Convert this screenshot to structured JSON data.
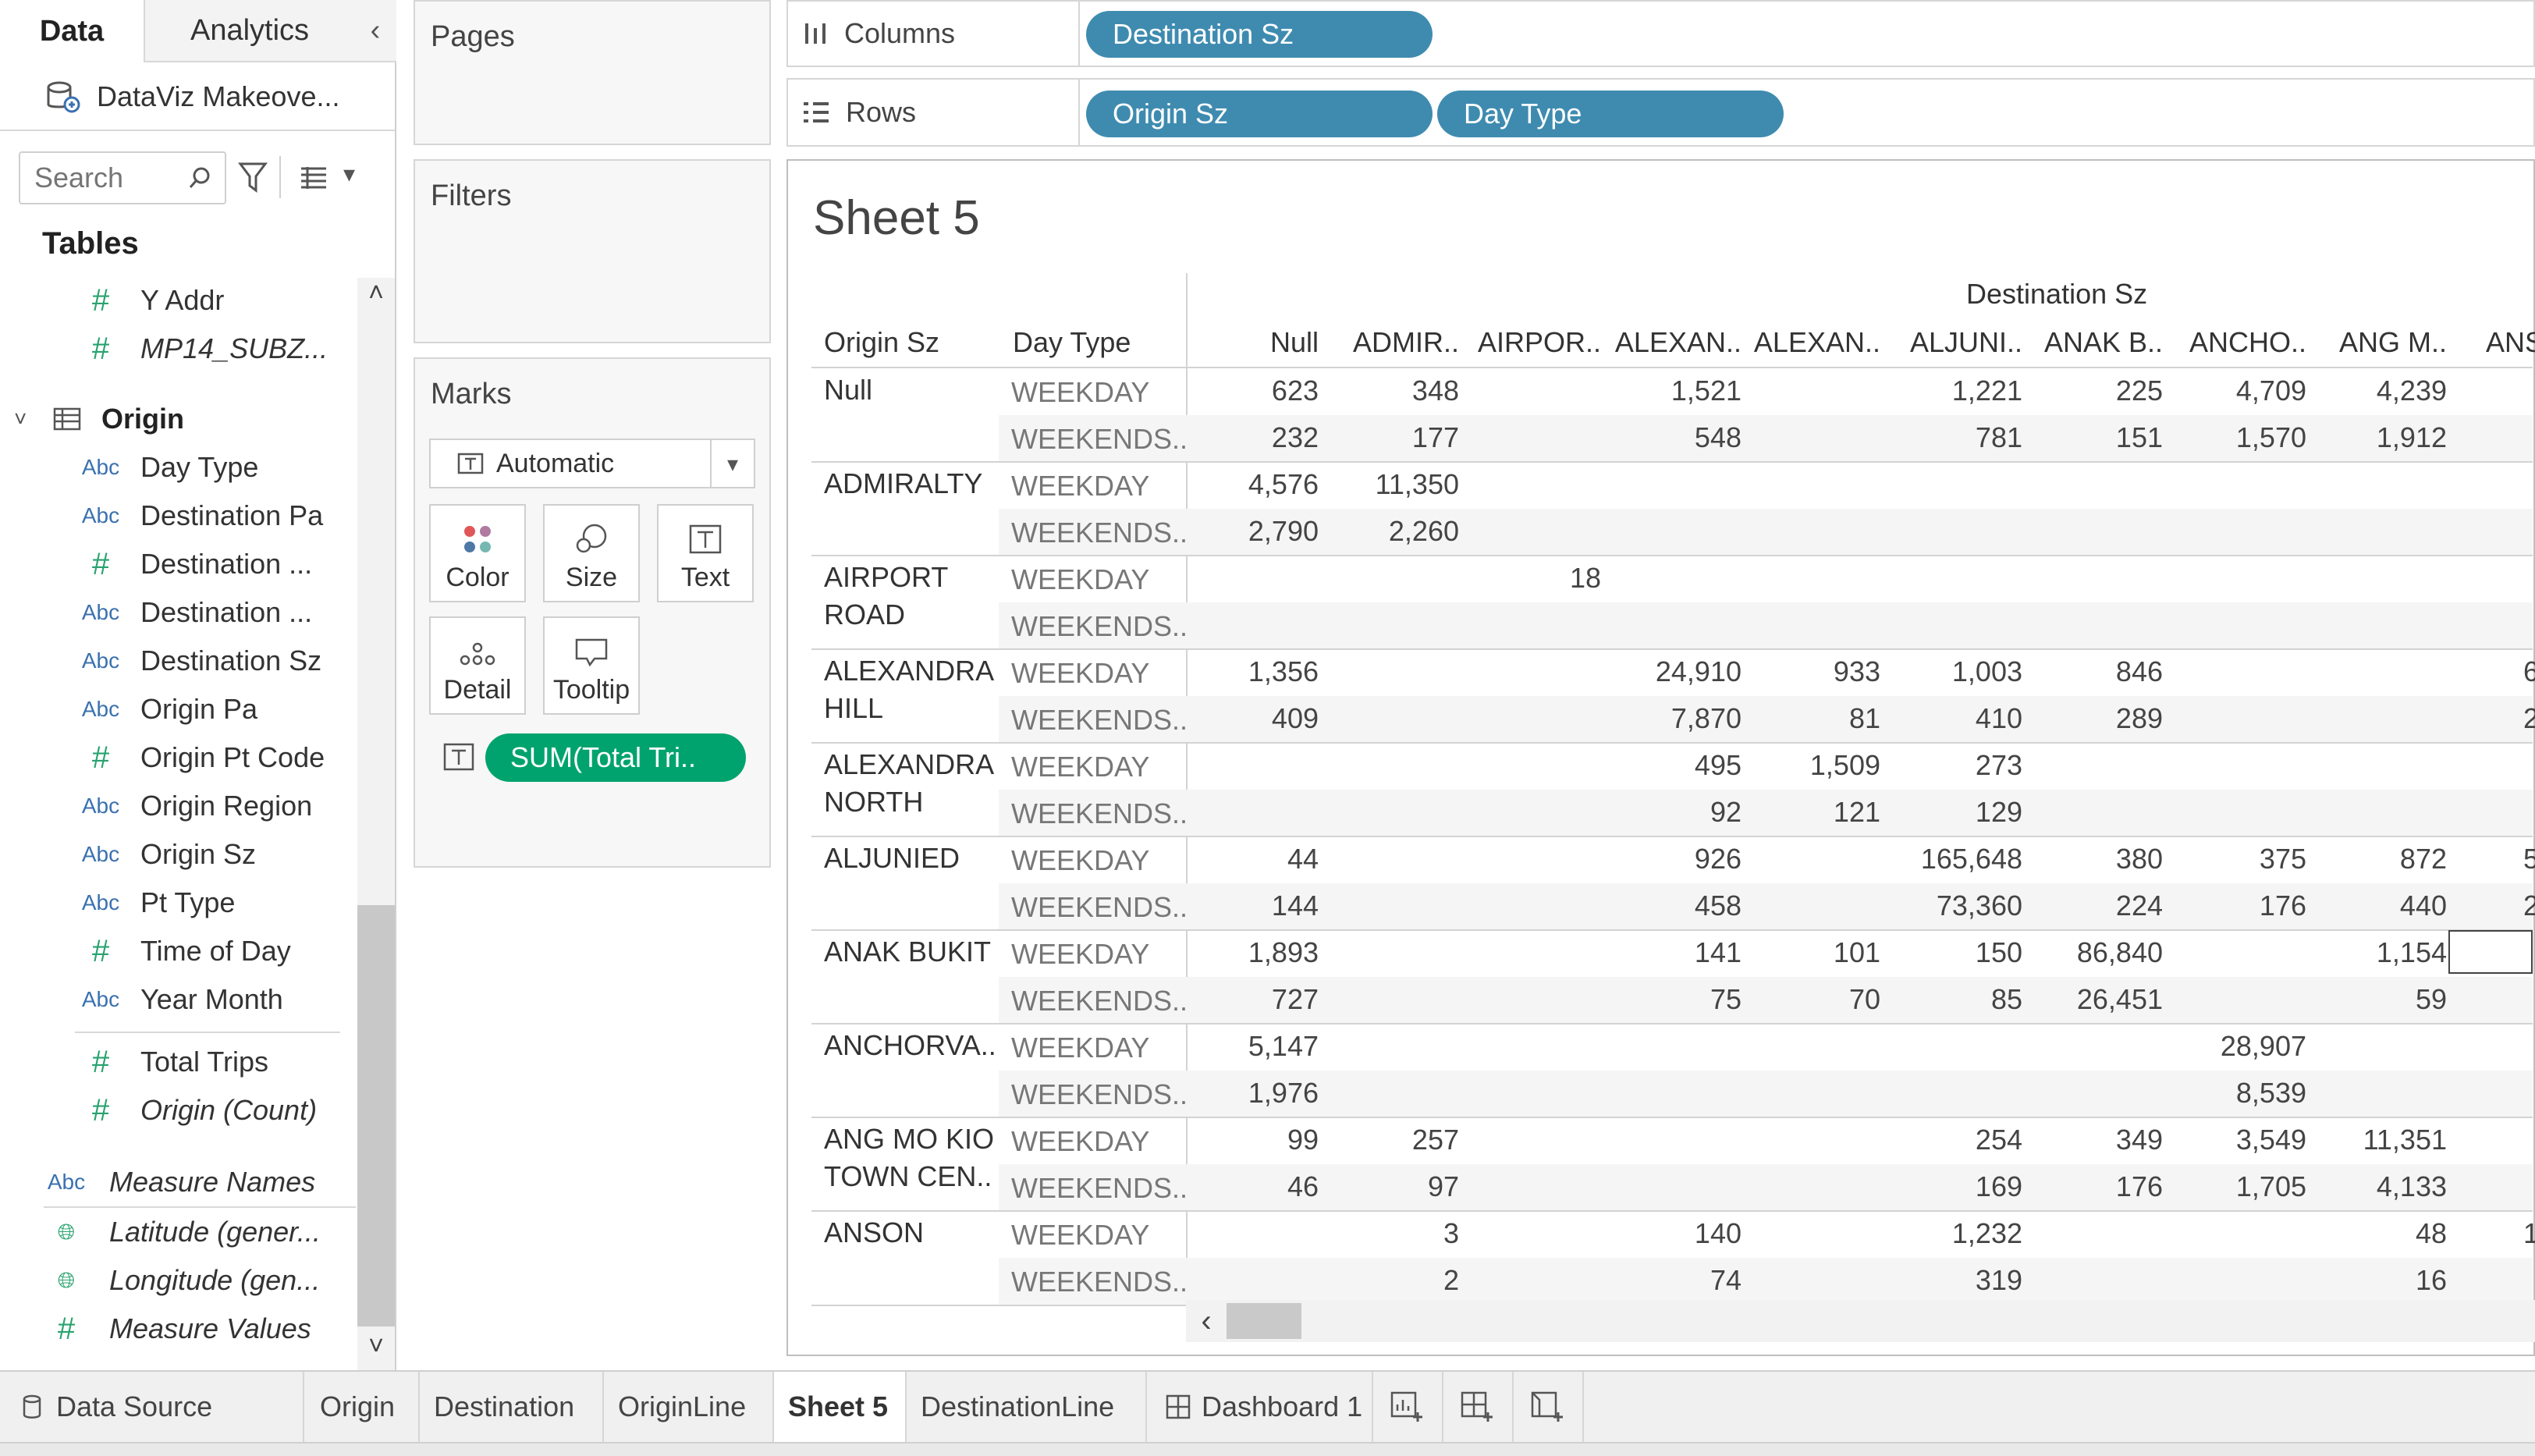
{
  "left_pane": {
    "tab_data": "Data",
    "tab_analytics": "Analytics",
    "datasource_name": "DataViz Makeove...",
    "search_placeholder": "Search",
    "tables_heading": "Tables",
    "fields_top": [
      {
        "type": "#",
        "name": "Y Addr"
      },
      {
        "type": "#",
        "name": "MP14_SUBZ..."
      }
    ],
    "origin_table": "Origin",
    "origin_fields": [
      {
        "type": "Abc",
        "name": "Day Type"
      },
      {
        "type": "Abc",
        "name": "Destination Pa"
      },
      {
        "type": "#",
        "name": "Destination ..."
      },
      {
        "type": "Abc",
        "name": "Destination ..."
      },
      {
        "type": "Abc",
        "name": "Destination Sz"
      },
      {
        "type": "Abc",
        "name": "Origin Pa"
      },
      {
        "type": "#",
        "name": "Origin Pt Code"
      },
      {
        "type": "Abc",
        "name": "Origin Region"
      },
      {
        "type": "Abc",
        "name": "Origin Sz"
      },
      {
        "type": "Abc",
        "name": "Pt Type"
      },
      {
        "type": "#",
        "name": "Time of Day"
      },
      {
        "type": "Abc",
        "name": "Year Month"
      }
    ],
    "origin_measures": [
      {
        "type": "#",
        "name": "Total Trips"
      },
      {
        "type": "#",
        "name": "Origin (Count)"
      }
    ],
    "extra_fields": [
      {
        "type": "Abc",
        "name": "Measure Names"
      },
      {
        "type": "geo",
        "name": "Latitude (gener..."
      },
      {
        "type": "geo",
        "name": "Longitude (gen..."
      },
      {
        "type": "#",
        "name": "Measure Values"
      }
    ]
  },
  "cards": {
    "pages": "Pages",
    "filters": "Filters",
    "marks": "Marks",
    "mark_type": "Automatic",
    "color": "Color",
    "size": "Size",
    "text": "Text",
    "detail": "Detail",
    "tooltip": "Tooltip",
    "text_pill": "SUM(Total Tri.."
  },
  "shelves": {
    "columns_label": "Columns",
    "rows_label": "Rows",
    "columns_pills": [
      "Destination Sz"
    ],
    "rows_pills": [
      "Origin Sz",
      "Day Type"
    ]
  },
  "view": {
    "sheet_title": "Sheet 5",
    "col_group_header": "Destination Sz",
    "row_header_1": "Origin Sz",
    "row_header_2": "Day Type",
    "columns": [
      "Null",
      "ADMIR..",
      "AIRPOR..",
      "ALEXAN..",
      "ALEXAN..",
      "ALJUNI..",
      "ANAK B..",
      "ANCHO..",
      "ANG M..",
      "ANS"
    ],
    "rows": [
      {
        "origin": "Null",
        "day": "WEEKDAY",
        "values": [
          "623",
          "348",
          "",
          "1,521",
          "",
          "1,221",
          "225",
          "4,709",
          "4,239",
          ""
        ]
      },
      {
        "origin": "",
        "day": "WEEKENDS..",
        "values": [
          "232",
          "177",
          "",
          "548",
          "",
          "781",
          "151",
          "1,570",
          "1,912",
          ""
        ]
      },
      {
        "origin": "ADMIRALTY",
        "day": "WEEKDAY",
        "values": [
          "4,576",
          "11,350",
          "",
          "",
          "",
          "",
          "",
          "",
          "",
          ""
        ]
      },
      {
        "origin": "",
        "day": "WEEKENDS..",
        "values": [
          "2,790",
          "2,260",
          "",
          "",
          "",
          "",
          "",
          "",
          "",
          ""
        ]
      },
      {
        "origin": "AIRPORT ROAD",
        "day": "WEEKDAY",
        "values": [
          "",
          "",
          "18",
          "",
          "",
          "",
          "",
          "",
          "",
          ""
        ]
      },
      {
        "origin": "",
        "day": "WEEKENDS..",
        "values": [
          "",
          "",
          "",
          "",
          "",
          "",
          "",
          "",
          "",
          ""
        ]
      },
      {
        "origin": "ALEXANDRA HILL",
        "day": "WEEKDAY",
        "values": [
          "1,356",
          "",
          "",
          "24,910",
          "933",
          "1,003",
          "846",
          "",
          "",
          "6"
        ]
      },
      {
        "origin": "",
        "day": "WEEKENDS..",
        "values": [
          "409",
          "",
          "",
          "7,870",
          "81",
          "410",
          "289",
          "",
          "",
          "2"
        ]
      },
      {
        "origin": "ALEXANDRA NORTH",
        "day": "WEEKDAY",
        "values": [
          "",
          "",
          "",
          "495",
          "1,509",
          "273",
          "",
          "",
          "",
          ""
        ]
      },
      {
        "origin": "",
        "day": "WEEKENDS..",
        "values": [
          "",
          "",
          "",
          "92",
          "121",
          "129",
          "",
          "",
          "",
          ""
        ]
      },
      {
        "origin": "ALJUNIED",
        "day": "WEEKDAY",
        "values": [
          "44",
          "",
          "",
          "926",
          "",
          "165,648",
          "380",
          "375",
          "872",
          "5"
        ]
      },
      {
        "origin": "",
        "day": "WEEKENDS..",
        "values": [
          "144",
          "",
          "",
          "458",
          "",
          "73,360",
          "224",
          "176",
          "440",
          "2"
        ]
      },
      {
        "origin": "ANAK BUKIT",
        "day": "WEEKDAY",
        "values": [
          "1,893",
          "",
          "",
          "141",
          "101",
          "150",
          "86,840",
          "",
          "1,154",
          ""
        ]
      },
      {
        "origin": "",
        "day": "WEEKENDS..",
        "values": [
          "727",
          "",
          "",
          "75",
          "70",
          "85",
          "26,451",
          "",
          "59",
          ""
        ]
      },
      {
        "origin": "ANCHORVA..",
        "day": "WEEKDAY",
        "values": [
          "5,147",
          "",
          "",
          "",
          "",
          "",
          "",
          "28,907",
          "",
          ""
        ]
      },
      {
        "origin": "",
        "day": "WEEKENDS..",
        "values": [
          "1,976",
          "",
          "",
          "",
          "",
          "",
          "",
          "8,539",
          "",
          ""
        ]
      },
      {
        "origin": "ANG MO KIO TOWN CEN..",
        "day": "WEEKDAY",
        "values": [
          "99",
          "257",
          "",
          "",
          "",
          "254",
          "349",
          "3,549",
          "11,351",
          ""
        ]
      },
      {
        "origin": "",
        "day": "WEEKENDS..",
        "values": [
          "46",
          "97",
          "",
          "",
          "",
          "169",
          "176",
          "1,705",
          "4,133",
          ""
        ]
      },
      {
        "origin": "ANSON",
        "day": "WEEKDAY",
        "values": [
          "",
          "3",
          "",
          "140",
          "",
          "1,232",
          "",
          "",
          "48",
          "1"
        ]
      },
      {
        "origin": "",
        "day": "WEEKENDS..",
        "values": [
          "",
          "2",
          "",
          "74",
          "",
          "319",
          "",
          "",
          "16",
          ""
        ]
      }
    ]
  },
  "bottom_tabs": {
    "data_source": "Data Source",
    "sheets": [
      "Origin",
      "Destination",
      "OriginLine",
      "Sheet 5",
      "DestinationLine"
    ],
    "dashboard": "Dashboard 1"
  },
  "colors": {
    "pill_blue": "#3f8bb0",
    "pill_green": "#00a36d",
    "measure_green": "#29a36f",
    "dimension_blue": "#3a71b0"
  }
}
